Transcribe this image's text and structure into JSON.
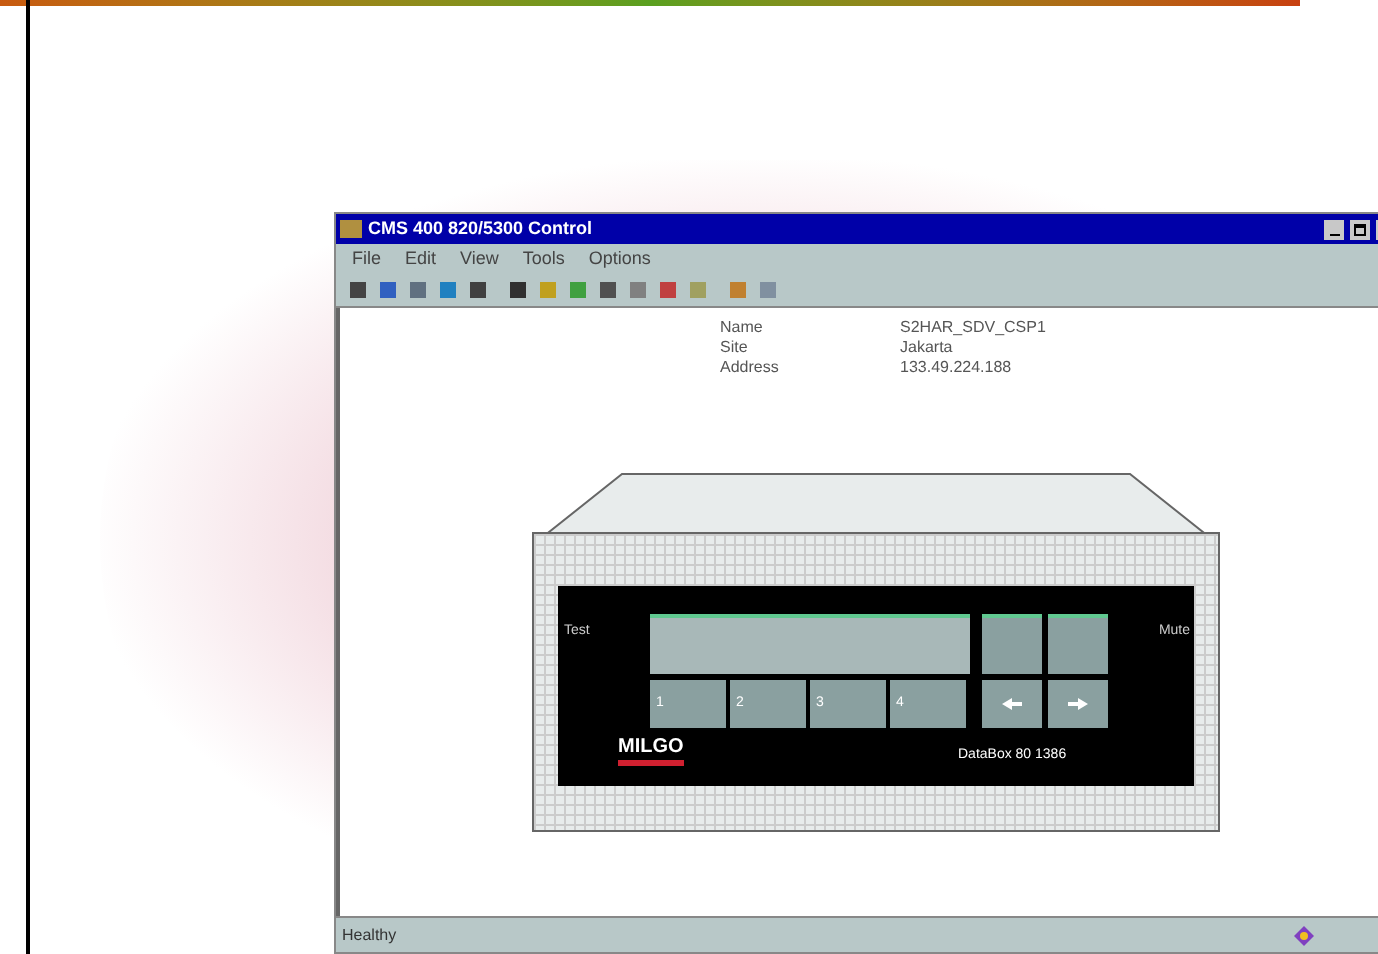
{
  "window": {
    "title": "CMS 400 820/5300 Control"
  },
  "menu": [
    "File",
    "Edit",
    "View",
    "Tools",
    "Options"
  ],
  "info": [
    {
      "label": "Name",
      "value": "S2HAR_SDV_CSP1"
    },
    {
      "label": "Site",
      "value": "Jakarta"
    },
    {
      "label": "Address",
      "value": "133.49.224.188"
    }
  ],
  "device": {
    "left_label": "Test",
    "right_label": "Mute",
    "softkeys": [
      "1",
      "2",
      "3",
      "4"
    ],
    "logo": "MILGO",
    "model": "DataBox 80 1386"
  },
  "status_bar": {
    "text": "Healthy"
  }
}
